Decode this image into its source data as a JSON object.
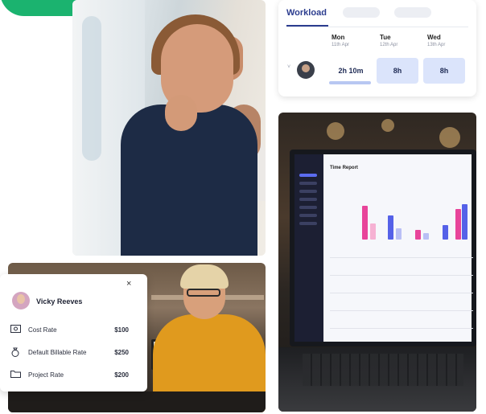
{
  "workload_card": {
    "title": "Workload",
    "days": [
      {
        "name": "Mon",
        "date": "11th Apr"
      },
      {
        "name": "Tue",
        "date": "12th Apr"
      },
      {
        "name": "Wed",
        "date": "13th Apr"
      }
    ],
    "row": {
      "hours": [
        "2h 10m",
        "8h",
        "8h"
      ]
    }
  },
  "rates_card": {
    "user_name": "Vicky Reeves",
    "close_icon": "×",
    "rows": [
      {
        "icon": "cash-icon",
        "label": "Cost Rate",
        "value": "$100"
      },
      {
        "icon": "money-bag-icon",
        "label": "Default Billable Rate",
        "value": "$250"
      },
      {
        "icon": "folder-icon",
        "label": "Project Rate",
        "value": "$200"
      }
    ]
  },
  "laptop_screen": {
    "title": "Time Report"
  },
  "colors": {
    "brand_green": "#1bb36f",
    "brand_navy": "#2c3d8f",
    "highlight_blue": "#dbe4fb"
  }
}
